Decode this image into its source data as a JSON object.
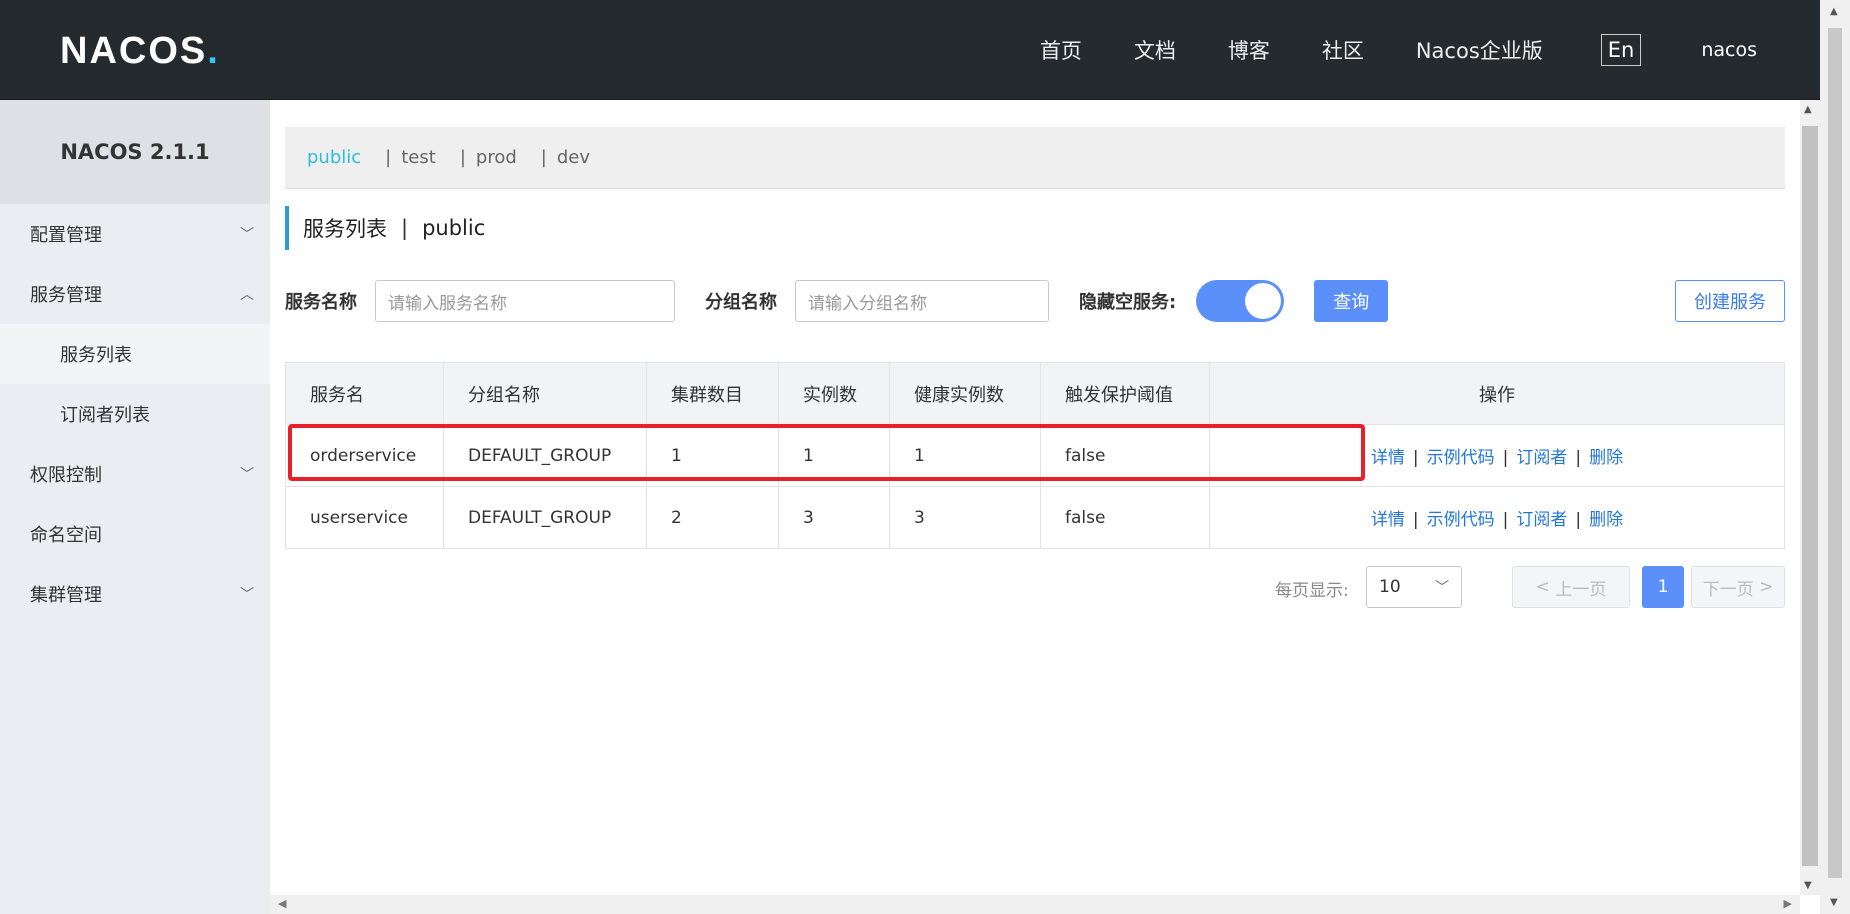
{
  "header": {
    "logo": "NACOS",
    "nav": [
      "首页",
      "文档",
      "博客",
      "社区",
      "Nacos企业版"
    ],
    "lang": "En",
    "user": "nacos"
  },
  "sidebar": {
    "version": "NACOS 2.1.1",
    "items": [
      {
        "label": "配置管理",
        "chevron": "chevron-down-icon"
      },
      {
        "label": "服务管理",
        "chevron": "chevron-up-icon"
      },
      {
        "label": "服务列表"
      },
      {
        "label": "订阅者列表"
      },
      {
        "label": "权限控制",
        "chevron": "chevron-down-icon"
      },
      {
        "label": "命名空间"
      },
      {
        "label": "集群管理",
        "chevron": "chevron-down-icon"
      }
    ]
  },
  "namespaces": {
    "active": "public",
    "others": [
      "test",
      "prod",
      "dev"
    ]
  },
  "title": {
    "main": "服务列表",
    "separator": "|",
    "namespace": "public"
  },
  "filters": {
    "service_name_label": "服务名称",
    "service_name_placeholder": "请输入服务名称",
    "group_name_label": "分组名称",
    "group_name_placeholder": "请输入分组名称",
    "hide_empty_label": "隐藏空服务:",
    "query_button": "查询",
    "create_button": "创建服务"
  },
  "table": {
    "headers": [
      "服务名",
      "分组名称",
      "集群数目",
      "实例数",
      "健康实例数",
      "触发保护阈值",
      "操作"
    ],
    "rows": [
      [
        "orderservice",
        "DEFAULT_GROUP",
        "1",
        "1",
        "1",
        "false"
      ],
      [
        "userservice",
        "DEFAULT_GROUP",
        "2",
        "3",
        "3",
        "false"
      ]
    ],
    "ops": [
      "详情",
      "示例代码",
      "订阅者",
      "删除"
    ]
  },
  "pagination": {
    "per_page_label": "每页显示:",
    "per_page": "10",
    "prev": "上一页",
    "page": "1",
    "next": "下一页"
  },
  "colors": {
    "header_bg": "#252a2f",
    "accent": "#5b8ff9",
    "highlight_box": "#e8202a"
  }
}
